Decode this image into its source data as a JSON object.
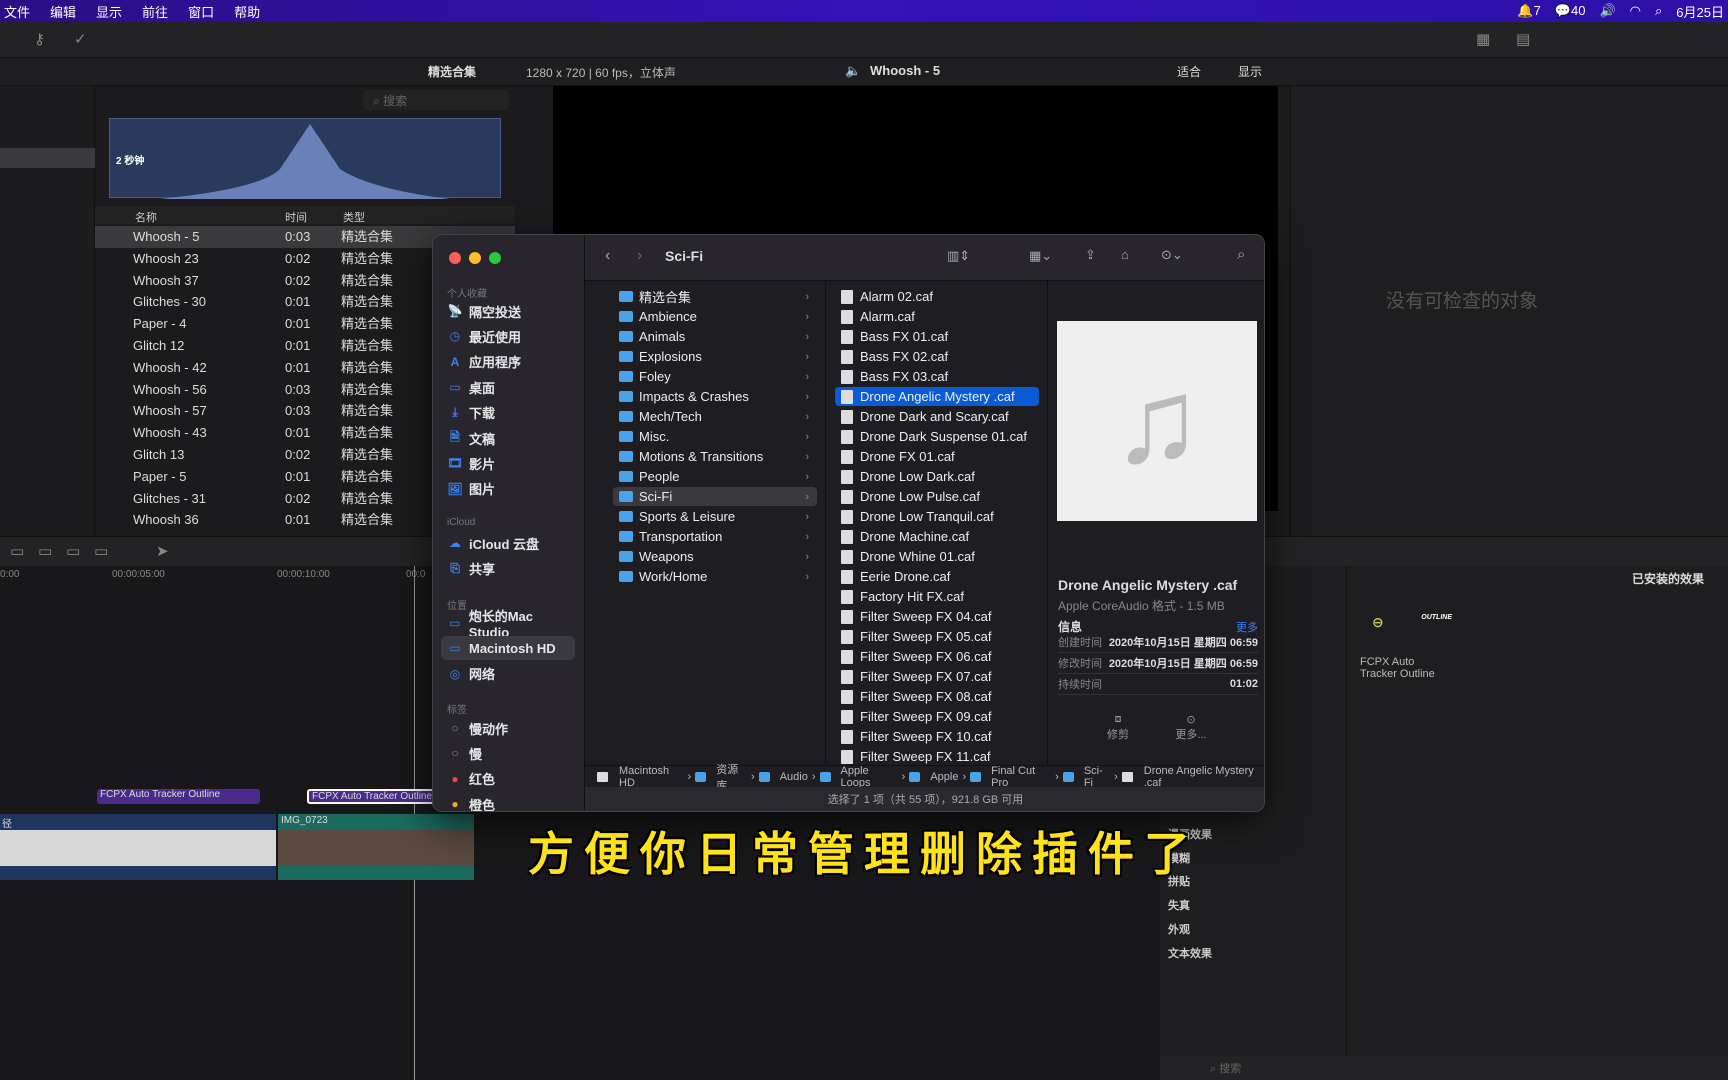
{
  "menubar": {
    "items": [
      "文件",
      "编辑",
      "显示",
      "前往",
      "窗口",
      "帮助"
    ],
    "status": {
      "notifications": "7",
      "wechat": "40",
      "date": "6月25日"
    }
  },
  "browser": {
    "collection": "精选合集",
    "search_placeholder": "搜索",
    "waveform_label": "2 秒钟",
    "columns": [
      "名称",
      "时间",
      "类型"
    ],
    "rows": [
      [
        "Whoosh - 5",
        "0:03",
        "精选合集"
      ],
      [
        "Whoosh 23",
        "0:02",
        "精选合集"
      ],
      [
        "Whoosh 37",
        "0:02",
        "精选合集"
      ],
      [
        "Glitches - 30",
        "0:01",
        "精选合集"
      ],
      [
        "Paper - 4",
        "0:01",
        "精选合集"
      ],
      [
        "Glitch 12",
        "0:01",
        "精选合集"
      ],
      [
        "Whoosh - 42",
        "0:01",
        "精选合集"
      ],
      [
        "Whoosh - 56",
        "0:03",
        "精选合集"
      ],
      [
        "Whoosh - 57",
        "0:03",
        "精选合集"
      ],
      [
        "Whoosh - 43",
        "0:01",
        "精选合集"
      ],
      [
        "Glitch 13",
        "0:02",
        "精选合集"
      ],
      [
        "Paper - 5",
        "0:01",
        "精选合集"
      ],
      [
        "Glitches - 31",
        "0:02",
        "精选合集"
      ],
      [
        "Whoosh 36",
        "0:01",
        "精选合集"
      ]
    ]
  },
  "viewer": {
    "format": "1280 x 720 | 60 fps，立体声",
    "clip": "Whoosh - 5",
    "fit": "适合",
    "display": "显示"
  },
  "inspector": {
    "empty": "没有可检查的对象"
  },
  "timeline": {
    "ruler": [
      "0:00",
      "00:00:05:00",
      "00:00:10:00",
      "00:0"
    ],
    "title_clip1": "FCPX Auto Tracker Outline",
    "title_clip2": "FCPX Auto Tracker Outline",
    "clip_a": "径",
    "clip_b": "IMG_0723"
  },
  "effects": {
    "header": "已安装的效果",
    "categories": [
      "漫画效果",
      "模糊",
      "拼贴",
      "失真",
      "外观",
      "文本效果"
    ],
    "item": "FCPX Auto Tracker Outline",
    "item_logo": "OUTLINE",
    "search_placeholder": "搜索"
  },
  "finder": {
    "title": "Sci-Fi",
    "sidebar": {
      "favorites_label": "个人收藏",
      "favorites": [
        "隔空投送",
        "最近使用",
        "应用程序",
        "桌面",
        "下载",
        "文稿",
        "影片",
        "图片"
      ],
      "icloud_label": "iCloud",
      "icloud": [
        "iCloud 云盘",
        "共享"
      ],
      "locations_label": "位置",
      "locations": [
        "炮长的Mac Studio",
        "Macintosh HD",
        "网络"
      ],
      "tags_label": "标签",
      "tags": [
        {
          "name": "慢动作",
          "color": ""
        },
        {
          "name": "慢",
          "color": ""
        },
        {
          "name": "红色",
          "color": "#e5484d"
        },
        {
          "name": "橙色",
          "color": "#f5a524"
        }
      ]
    },
    "folders": [
      "精选合集",
      "Ambience",
      "Animals",
      "Explosions",
      "Foley",
      "Impacts & Crashes",
      "Mech/Tech",
      "Misc.",
      "Motions & Transitions",
      "People",
      "Sci-Fi",
      "Sports & Leisure",
      "Transportation",
      "Weapons",
      "Work/Home"
    ],
    "selected_folder": "Sci-Fi",
    "files": [
      "Alarm 02.caf",
      "Alarm.caf",
      "Bass FX 01.caf",
      "Bass FX 02.caf",
      "Bass FX 03.caf",
      "Drone Angelic Mystery .caf",
      "Drone Dark and Scary.caf",
      "Drone Dark Suspense 01.caf",
      "Drone FX 01.caf",
      "Drone Low Dark.caf",
      "Drone Low Pulse.caf",
      "Drone Low Tranquil.caf",
      "Drone Machine.caf",
      "Drone Whine 01.caf",
      "Eerie Drone.caf",
      "Factory Hit FX.caf",
      "Filter Sweep FX 04.caf",
      "Filter Sweep FX 05.caf",
      "Filter Sweep FX 06.caf",
      "Filter Sweep FX 07.caf",
      "Filter Sweep FX 08.caf",
      "Filter Sweep FX 09.caf",
      "Filter Sweep FX 10.caf",
      "Filter Sweep FX 11.caf"
    ],
    "selected_file": "Drone Angelic Mystery .caf",
    "preview": {
      "name": "Drone Angelic Mystery .caf",
      "kind": "Apple CoreAudio 格式 - 1.5 MB",
      "info_label": "信息",
      "more_link": "更多",
      "rows": [
        [
          "创建时间",
          "2020年10月15日 星期四 06:59"
        ],
        [
          "修改时间",
          "2020年10月15日 星期四 06:59"
        ],
        [
          "持续时间",
          "01:02"
        ]
      ],
      "trim": "修剪",
      "more": "更多..."
    },
    "path": [
      "Macintosh HD",
      "资源库",
      "Audio",
      "Apple Loops",
      "Apple",
      "Final Cut Pro",
      "Sci-Fi",
      "Drone Angelic Mystery .caf"
    ],
    "status": "选择了 1 项（共 55 项），921.8 GB 可用"
  },
  "subtitle": "方便你日常管理删除插件了"
}
